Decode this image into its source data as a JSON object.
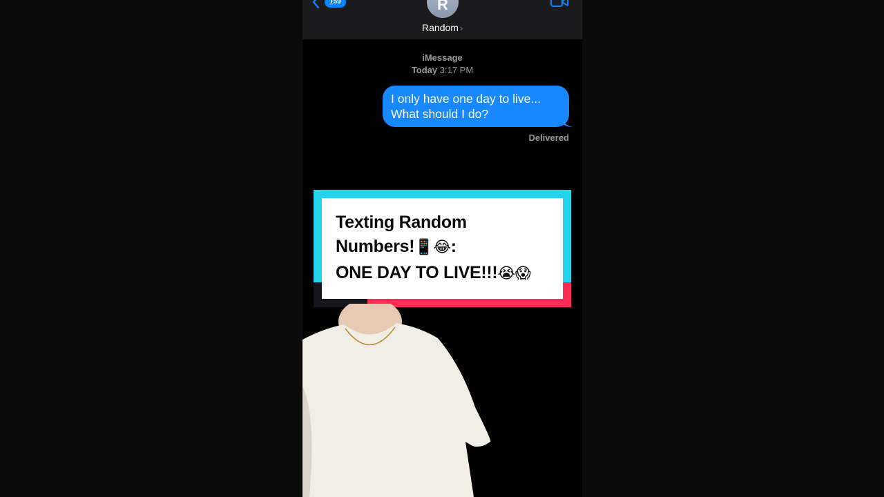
{
  "header": {
    "unread_count": "159",
    "avatar_initial": "R",
    "contact_name": "Random",
    "contact_chevron": "›"
  },
  "conversation": {
    "service": "iMessage",
    "time_prefix": "Today",
    "time": "3:17 PM",
    "messages": [
      {
        "from": "me",
        "lines": [
          "I only have one day to live...",
          "What should I do?"
        ]
      }
    ],
    "status": "Delivered"
  },
  "overlay": {
    "line1": "Texting Random",
    "line2_text": "Numbers!",
    "line2_emojis": "📱😂",
    "line2_suffix": ":",
    "line3_text": "ONE DAY TO LIVE!!!",
    "line3_emojis": "😭😱"
  },
  "icons": {
    "back": "chevron-left-icon",
    "video": "video-camera-icon",
    "info_chevron": "chevron-right-icon"
  },
  "colors": {
    "bubble_blue": "#1888fe",
    "accent_cyan": "#25d3ea",
    "accent_red": "#fd2c55",
    "badge_blue": "#0a84ff"
  }
}
